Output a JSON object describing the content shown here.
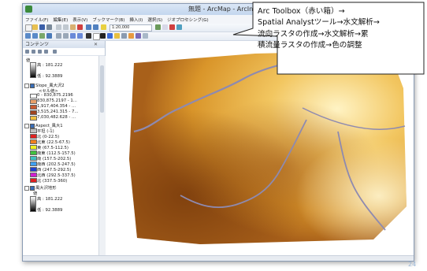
{
  "window": {
    "title": "無題 - ArcMap - ArcInfo"
  },
  "menu": [
    "ファイル(F)",
    "編集(E)",
    "表示(V)",
    "ブックマーク(B)",
    "挿入(I)",
    "選択(S)",
    "ジオプロセシング(G)"
  ],
  "toolbar": {
    "scale": "1:20,000"
  },
  "toc": {
    "title": "コンテンツ",
    "layers": [
      {
        "label_high": "高 : 181.222",
        "label_low": "低 : 92.3889"
      },
      {
        "name": "Slope_風大沢2",
        "field": "<セル値>",
        "classes": [
          {
            "label": "0 - 830,875.2196",
            "color": "#ffffff"
          },
          {
            "label": "830,875.2197 - 1...",
            "color": "#e8a06a"
          },
          {
            "label": "1,917,404.354 - ...",
            "color": "#c85a30"
          },
          {
            "label": "3,515,241.315 - 7...",
            "color": "#a04420"
          },
          {
            "label": "7,030,482.628 - ...",
            "color": "#f0c040"
          }
        ]
      },
      {
        "name": "Aspect_風大1",
        "classes": [
          {
            "label": "平坦 (-1)",
            "color": "#c0c0c0"
          },
          {
            "label": "北 (0-22.5)",
            "color": "#e02020"
          },
          {
            "label": "北東 (22.5-67.5)",
            "color": "#f08020"
          },
          {
            "label": "東 (67.5-112.5)",
            "color": "#f0f020"
          },
          {
            "label": "南東 (112.5-157.5)",
            "color": "#40c040"
          },
          {
            "label": "南 (157.5-202.5)",
            "color": "#40c0c0"
          },
          {
            "label": "南西 (202.5-247.5)",
            "color": "#40a0f0"
          },
          {
            "label": "西 (247.5-292.5)",
            "color": "#2040d0"
          },
          {
            "label": "北西 (292.5-337.5)",
            "color": "#d020d0"
          },
          {
            "label": "北 (337.5-360)",
            "color": "#e02020"
          }
        ]
      },
      {
        "name": "風大沢地形",
        "value_label": "値",
        "label_high": "高 : 181.222",
        "label_low": "低 : 92.3889"
      }
    ]
  },
  "callout": {
    "text": "Arc Toolbox（赤い箱）→\nSpatial Analystツール→水文解析→\n流向ラスタの作成→水文解析→累\n積流量ラスタの作成→色の調整"
  },
  "page_number": "24",
  "colors": {
    "dem_low": "#8a4a10",
    "dem_mid": "#d9a030",
    "dem_high": "#fff0b0",
    "stream": "#8e8ab0"
  }
}
